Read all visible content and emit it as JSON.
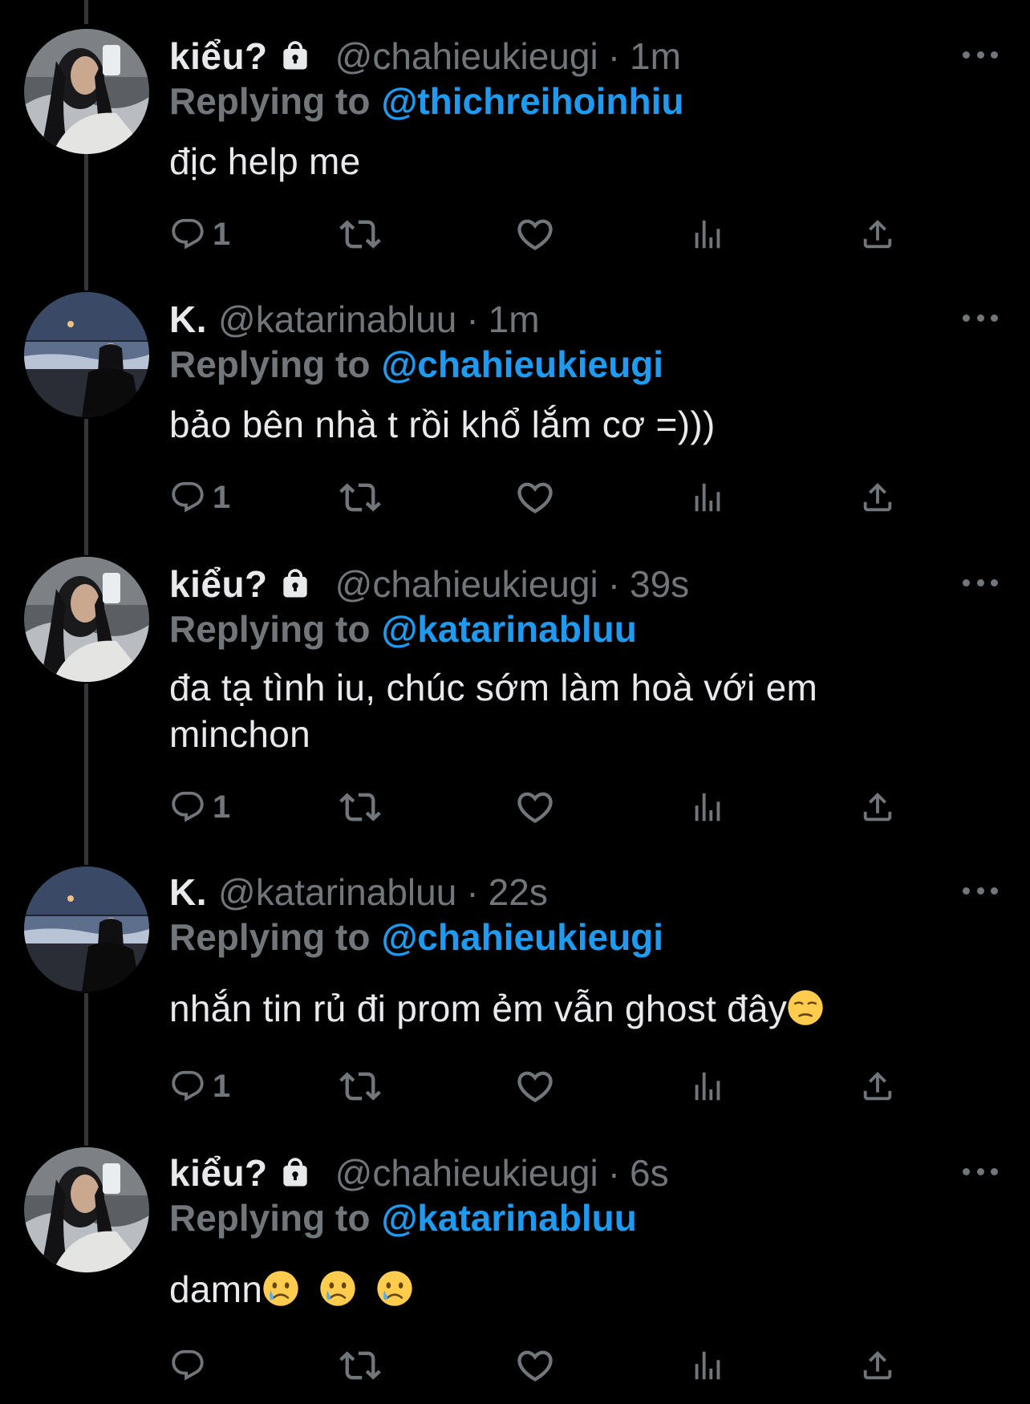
{
  "colors": {
    "background": "#000000",
    "text": "#e7e9ea",
    "muted": "#71767b",
    "accent": "#1d9bf0",
    "thread_line": "#333639"
  },
  "tweets": [
    {
      "name": "kiểu?",
      "protected": true,
      "handle": "@chahieukieugi",
      "separator": "·",
      "time": "1m",
      "replying_prefix": "Replying to",
      "replying_to": "@thichreihoinhiu",
      "text_lines": [
        "địc help me"
      ],
      "reply_count": "1",
      "icons": [
        "reply-icon",
        "retweet-icon",
        "like-icon",
        "views-icon",
        "share-icon"
      ]
    },
    {
      "name": "K.",
      "protected": false,
      "handle": "@katarinabluu",
      "separator": "·",
      "time": "1m",
      "replying_prefix": "Replying to",
      "replying_to": "@chahieukieugi",
      "text_lines": [
        "bảo bên nhà t rồi khổ lắm cơ =)))"
      ],
      "reply_count": "1"
    },
    {
      "name": "kiểu?",
      "protected": true,
      "handle": "@chahieukieugi",
      "separator": "·",
      "time": "39s",
      "replying_prefix": "Replying to",
      "replying_to": "@katarinabluu",
      "text_lines": [
        "đa tạ tình iu, chúc sớm làm hoà với em",
        "minchon"
      ],
      "reply_count": "1"
    },
    {
      "name": "K.",
      "protected": false,
      "handle": "@katarinabluu",
      "separator": "·",
      "time": "22s",
      "replying_prefix": "Replying to",
      "replying_to": "@chahieukieugi",
      "text_lines": [
        "nhắn tin rủ đi prom ẻm vẫn ghost đây"
      ],
      "trailing_emoji": "pensive-face",
      "reply_count": "1"
    },
    {
      "name": "kiểu?",
      "protected": true,
      "handle": "@chahieukieugi",
      "separator": "·",
      "time": "6s",
      "replying_prefix": "Replying to",
      "replying_to": "@katarinabluu",
      "text_lines": [
        "damn"
      ],
      "trailing_emoji": "crying-face x3",
      "reply_count": ""
    }
  ]
}
